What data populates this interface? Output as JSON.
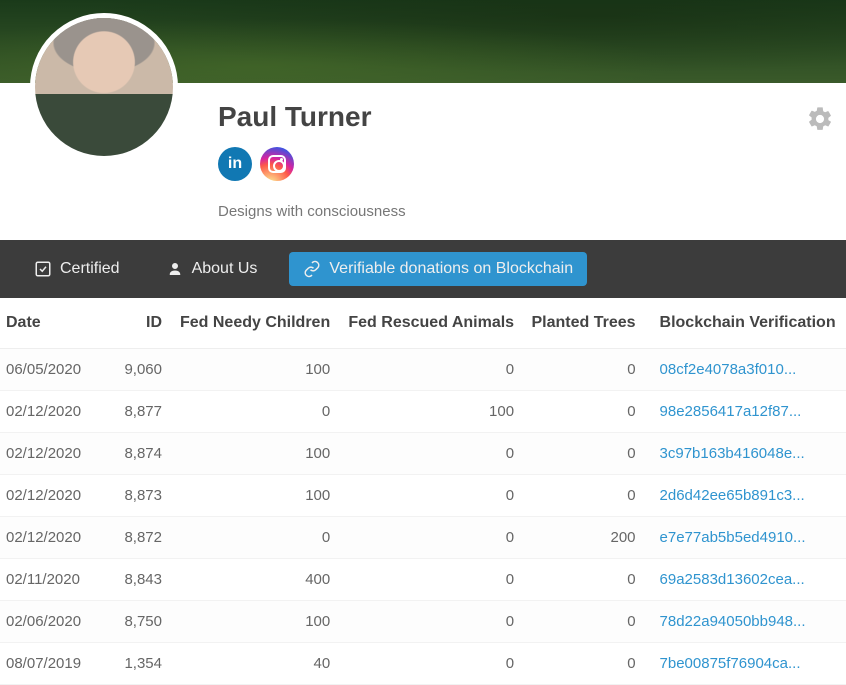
{
  "profile": {
    "name": "Paul Turner",
    "tagline": "Designs with consciousness"
  },
  "tabs": {
    "certified": "Certified",
    "about": "About Us",
    "donations": "Verifiable donations on Blockchain"
  },
  "table": {
    "headers": {
      "date": "Date",
      "id": "ID",
      "children": "Fed Needy Children",
      "animals": "Fed Rescued Animals",
      "trees": "Planted Trees",
      "verification": "Blockchain Verification"
    },
    "rows": [
      {
        "date": "06/05/2020",
        "id": "9,060",
        "children": "100",
        "animals": "0",
        "trees": "0",
        "hash": "08cf2e4078a3f010..."
      },
      {
        "date": "02/12/2020",
        "id": "8,877",
        "children": "0",
        "animals": "100",
        "trees": "0",
        "hash": "98e2856417a12f87..."
      },
      {
        "date": "02/12/2020",
        "id": "8,874",
        "children": "100",
        "animals": "0",
        "trees": "0",
        "hash": "3c97b163b416048e..."
      },
      {
        "date": "02/12/2020",
        "id": "8,873",
        "children": "100",
        "animals": "0",
        "trees": "0",
        "hash": "2d6d42ee65b891c3..."
      },
      {
        "date": "02/12/2020",
        "id": "8,872",
        "children": "0",
        "animals": "0",
        "trees": "200",
        "hash": "e7e77ab5b5ed4910..."
      },
      {
        "date": "02/11/2020",
        "id": "8,843",
        "children": "400",
        "animals": "0",
        "trees": "0",
        "hash": "69a2583d13602cea..."
      },
      {
        "date": "02/06/2020",
        "id": "8,750",
        "children": "100",
        "animals": "0",
        "trees": "0",
        "hash": "78d22a94050bb948..."
      },
      {
        "date": "08/07/2019",
        "id": "1,354",
        "children": "40",
        "animals": "0",
        "trees": "0",
        "hash": "7be00875f76904ca..."
      }
    ]
  }
}
